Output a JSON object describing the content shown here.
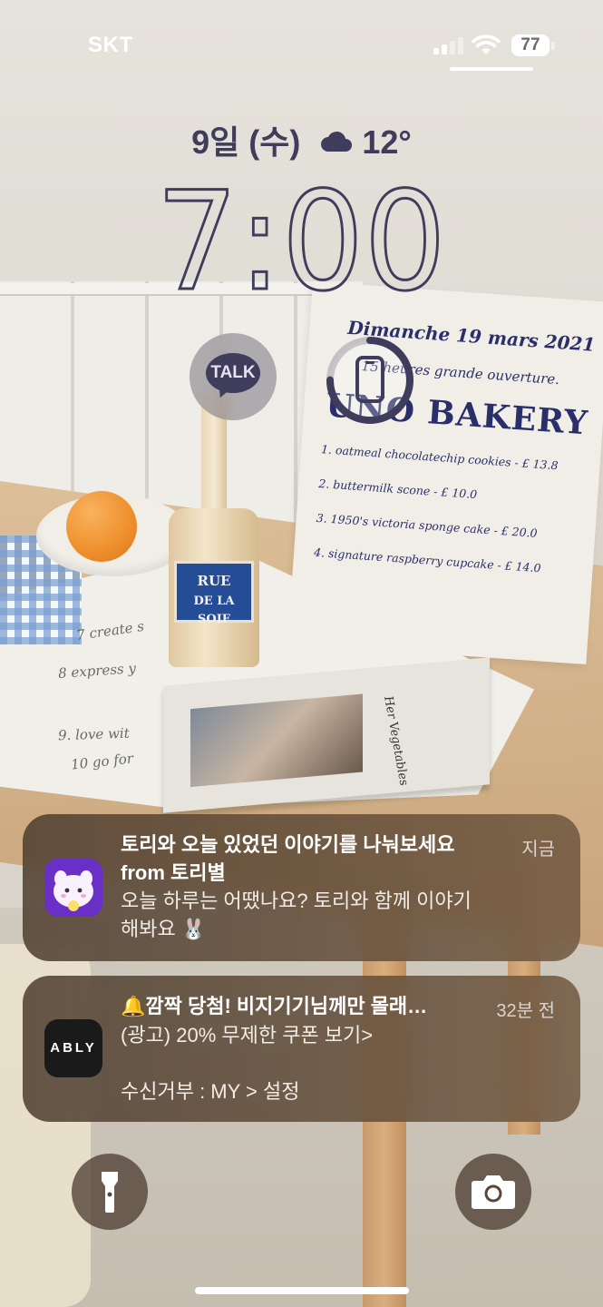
{
  "status_bar": {
    "carrier": "SKT",
    "signal_bars_active": 2,
    "signal_bars_total": 4,
    "battery_percent": "77"
  },
  "lock_screen": {
    "date": "9일 (수)",
    "weather_icon": "cloud-icon",
    "temperature": "12°",
    "time": "7:00"
  },
  "widgets": {
    "kakaotalk": {
      "label": "TALK",
      "icon": "talk-bubble-icon"
    },
    "screen_time": {
      "icon": "phone-icon",
      "ring_fill": 0.75
    }
  },
  "wallpaper": {
    "poster": {
      "line1": "Dimanche 19 mars 2021",
      "line2": "15 heures grande ouverture.",
      "brand": "UNO BAKERY",
      "items": [
        "1. oatmeal chocolatechip cookies - £ 13.8",
        "2. buttermilk scone - £ 10.0",
        "3. 1950's victoria sponge cake - £ 20.0",
        "4. signature raspberry cupcake - £ 14.0"
      ]
    },
    "bottle_label": [
      "RUE",
      "DE LA SOIF"
    ],
    "book_title": "Her Vegetables",
    "cloth_lines": [
      "7 create s",
      "8 express y",
      "9. love wit",
      "10 go for"
    ]
  },
  "notifications": [
    {
      "app": "토리별",
      "title": "토리와 오늘 있었던 이야기를 나눠보세요 from 토리별",
      "body": "오늘 하루는 어땠나요? 토리와 함께 이야기\n해봐요 🐰",
      "time": "지금"
    },
    {
      "app": "ABLY",
      "app_icon_text": "ABLY",
      "title": "🔔깜짝 당첨! 비지기기님께만 몰래…",
      "body": "(광고) 20% 무제한 쿠폰 보기>\n\n수신거부 : MY > 설정",
      "time": "32분 전"
    }
  ],
  "controls": {
    "flashlight": "flashlight-icon",
    "camera": "camera-icon"
  },
  "colors": {
    "clock_ink": "#3f3c5c",
    "notification_bg": "#5a4636",
    "tori_icon_bg": "#6a2fc7",
    "ably_icon_bg": "#1a1a1a"
  }
}
